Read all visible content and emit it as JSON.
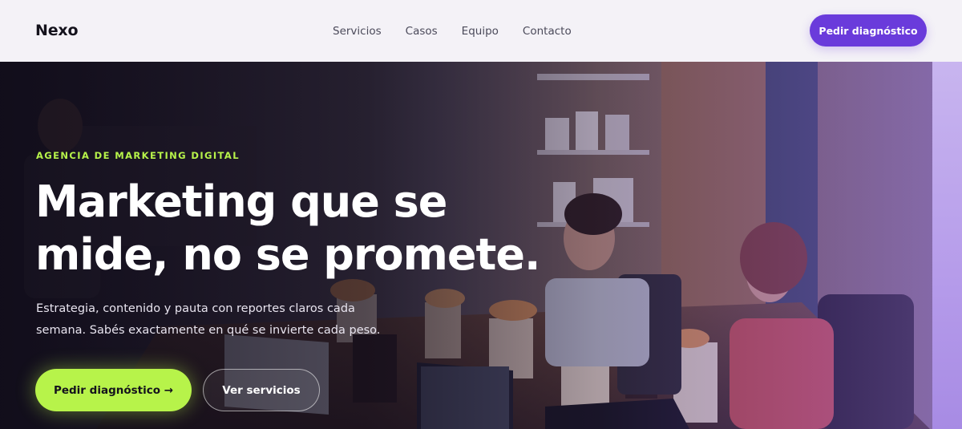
{
  "brand": {
    "logo_text": "Nexo"
  },
  "nav": {
    "links": [
      {
        "label": "Servicios"
      },
      {
        "label": "Casos"
      },
      {
        "label": "Equipo"
      },
      {
        "label": "Contacto"
      }
    ],
    "cta_label": "Pedir diagnóstico"
  },
  "hero": {
    "eyebrow": "AGENCIA DE MARKETING DIGITAL",
    "headline_line1": "Marketing que se",
    "headline_line2": "mide, no se promete.",
    "subtext_line1": "Estrategia, contenido y pauta con reportes claros cada",
    "subtext_line2": "semana. Sabés exactamente en qué se invierte cada peso.",
    "primary_cta": "Pedir diagnóstico →",
    "secondary_cta": "Ver servicios"
  },
  "colors": {
    "accent_purple": "#6a3bdb",
    "accent_lime": "#b7f34a",
    "nav_bg": "#f4f2f7",
    "text_dark": "#14121c"
  }
}
